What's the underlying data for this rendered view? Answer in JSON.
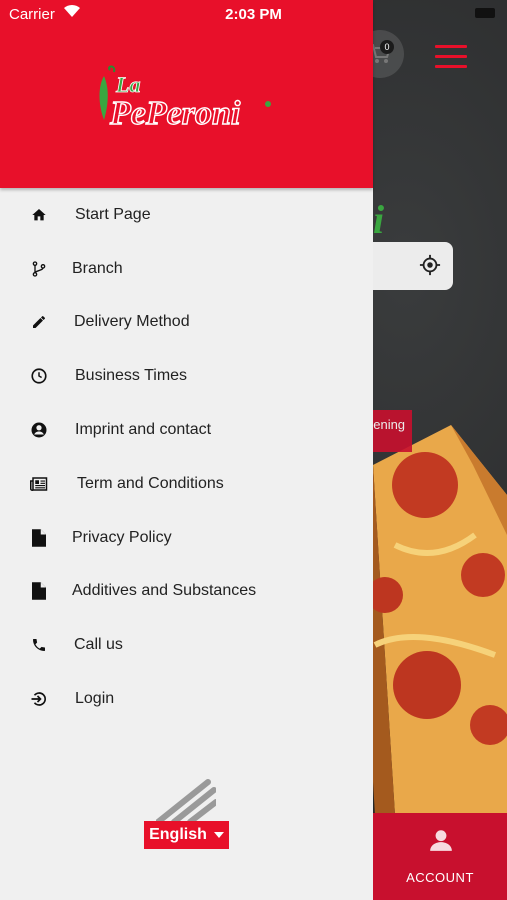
{
  "status_bar": {
    "carrier": "Carrier",
    "time": "2:03 PM"
  },
  "cart": {
    "count": "0"
  },
  "background": {
    "tag_text": "pening",
    "account_label": "ACCOUNT"
  },
  "logo": {
    "line1": "La",
    "line2": "PePeroni"
  },
  "menu": {
    "items": [
      {
        "label": "Start Page",
        "icon": "home-icon"
      },
      {
        "label": "Branch",
        "icon": "branch-icon"
      },
      {
        "label": "Delivery Method",
        "icon": "pencil-icon"
      },
      {
        "label": "Business Times",
        "icon": "clock-icon"
      },
      {
        "label": "Imprint and contact",
        "icon": "account-circle-icon"
      },
      {
        "label": "Term and Conditions",
        "icon": "newspaper-icon"
      },
      {
        "label": "Privacy Policy",
        "icon": "file-icon"
      },
      {
        "label": "Additives and Substances",
        "icon": "file-icon"
      },
      {
        "label": "Call us",
        "icon": "phone-icon"
      },
      {
        "label": "Login",
        "icon": "login-icon"
      }
    ]
  },
  "language": {
    "selected": "English"
  },
  "colors": {
    "brand_red": "#e8102a",
    "accent_green": "#3aa640",
    "drawer_bg": "#f0f0f0"
  }
}
